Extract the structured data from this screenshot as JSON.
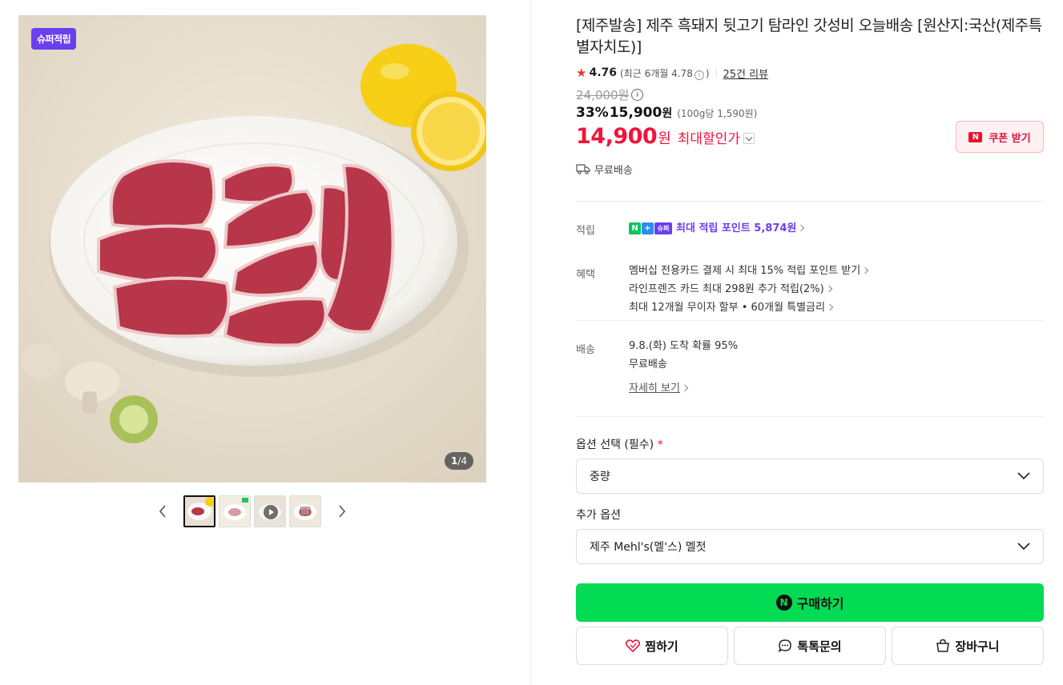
{
  "gallery": {
    "badge": "슈퍼적립",
    "counter_current": "1",
    "counter_total": "/4",
    "thumbnails": [
      "thumb-1",
      "thumb-2",
      "thumb-video",
      "thumb-4"
    ]
  },
  "product": {
    "title": "[제주발송] 제주 흑돼지 뒷고기 탐라인 갓성비 오늘배송 [원산지:국산(제주특별자치도)]",
    "rating": "4.76",
    "rating_recent_prefix": "(최근 6개월 4.78",
    "rating_recent_suffix": ")",
    "review_link": "25건 리뷰",
    "original_price": "24,000원",
    "discount_pct": "33%",
    "sale_price": "15,900",
    "sale_unit": "원",
    "per_100g": "(100g당 1,590원)",
    "max_price": "14,900",
    "max_unit": "원",
    "max_label": "최대할인가",
    "coupon_button": "쿠폰 받기",
    "free_shipping": "무료배송"
  },
  "benefits": {
    "points_label": "적립",
    "points_badge_n": "N",
    "points_badge_plus": "+",
    "points_badge_super": "슈퍼",
    "points_text": "최대 적립 포인트 5,874원",
    "benefit_label": "혜택",
    "benefit_items": [
      "멤버십 전용카드 결제 시 최대 15% 적립 포인트 받기",
      "라인프렌즈 카드 최대 298원 추가 적립(2%)",
      "최대 12개월 무이자 할부 • 60개월 특별금리"
    ]
  },
  "delivery": {
    "label": "배송",
    "arrival": "9.8.(화) 도착 확률 95%",
    "fee": "무료배송",
    "detail_link": "자세히 보기"
  },
  "options": {
    "required_label": "옵션 선택 (필수)",
    "required_mark": "*",
    "required_value": "중량",
    "extra_label": "추가 옵션",
    "extra_value": "제주 Mehl's(멜'스) 멜젓"
  },
  "actions": {
    "buy": "구매하기",
    "wish": "찜하기",
    "talk": "톡톡문의",
    "cart": "장바구니"
  },
  "colors": {
    "accent_red": "#f0143c",
    "naver_green": "#03db55",
    "super_purple": "#6b3ef0"
  }
}
